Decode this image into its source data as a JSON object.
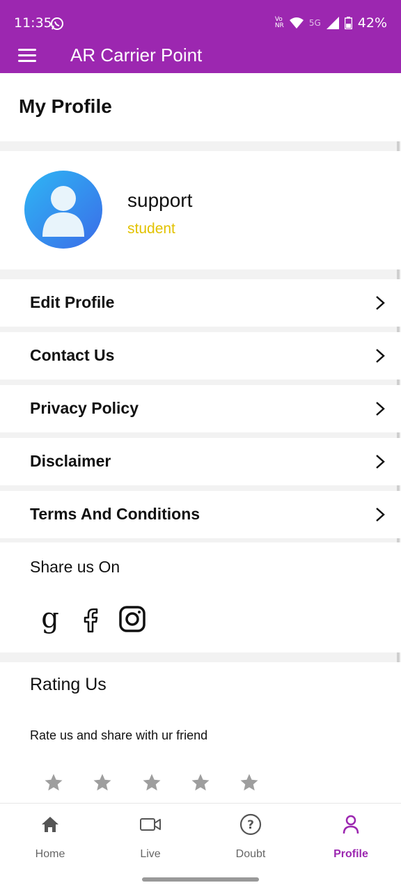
{
  "status_bar": {
    "time": "11:35",
    "network_label_top": "Vo",
    "network_label_bottom": "NR",
    "signal_text": "5G",
    "battery": "42%"
  },
  "app_bar": {
    "title": "AR Carrier Point",
    "menu_icon": "hamburger-icon",
    "color": "#9c27b0"
  },
  "page": {
    "title": "My Profile"
  },
  "user": {
    "name": "support",
    "role": "student",
    "role_color": "#e2c200"
  },
  "menu": {
    "items": [
      {
        "label": "Edit Profile"
      },
      {
        "label": "Contact Us"
      },
      {
        "label": "Privacy Policy"
      },
      {
        "label": "Disclaimer"
      },
      {
        "label": "Terms And Conditions"
      }
    ]
  },
  "share": {
    "title": "Share us On",
    "icons": [
      "google-icon",
      "facebook-icon",
      "instagram-icon"
    ]
  },
  "rating": {
    "title": "Rating Us",
    "subtitle": "Rate us and share with ur friend",
    "stars": 5,
    "value": 0
  },
  "bottom_nav": {
    "items": [
      {
        "label": "Home",
        "icon": "home-icon"
      },
      {
        "label": "Live",
        "icon": "video-icon"
      },
      {
        "label": "Doubt",
        "icon": "question-icon"
      },
      {
        "label": "Profile",
        "icon": "profile-icon",
        "active": true
      }
    ],
    "active_color": "#9c27b0"
  }
}
